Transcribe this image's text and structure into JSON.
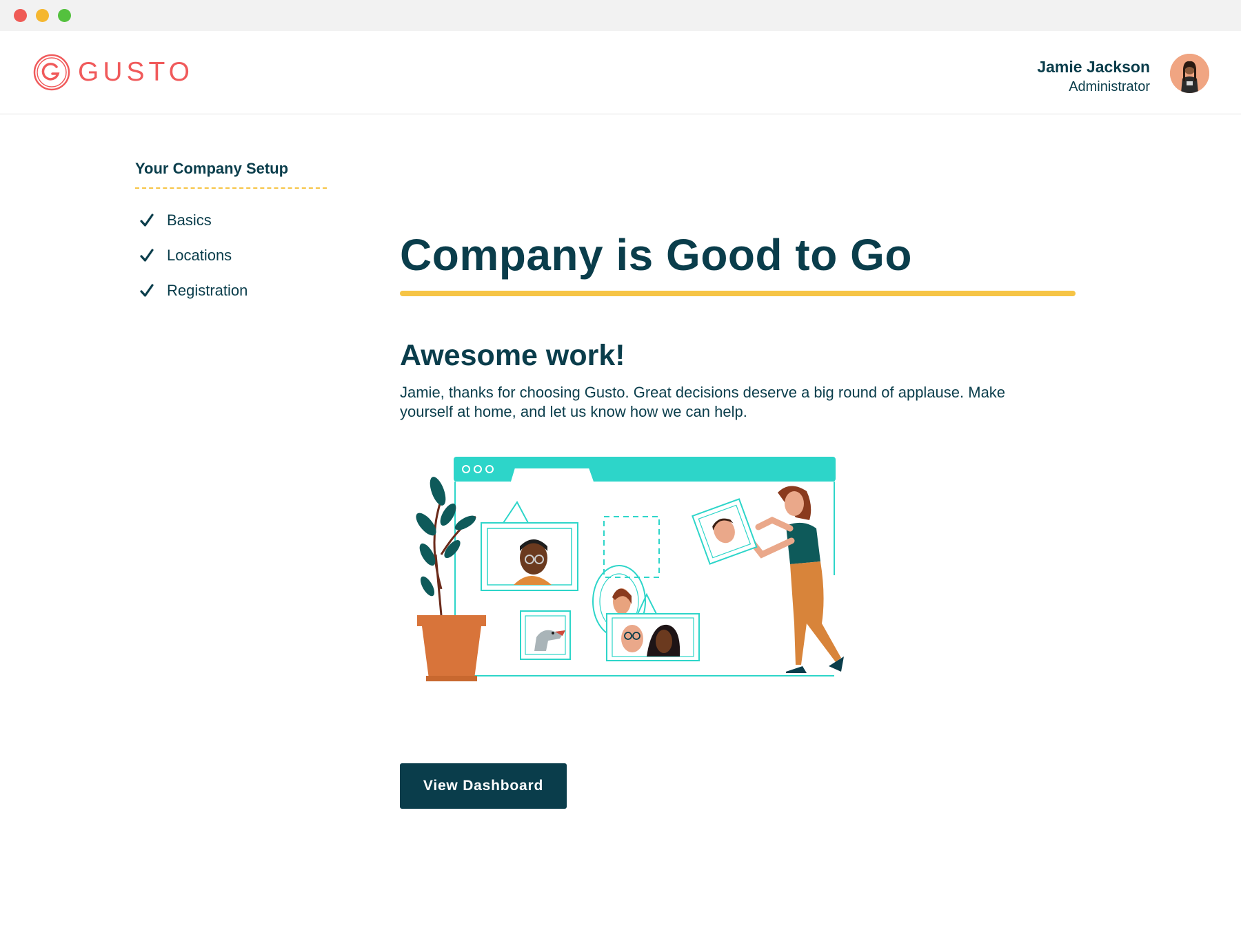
{
  "window": {
    "controls": [
      "close",
      "minimize",
      "maximize"
    ]
  },
  "header": {
    "logo_text": "GUSTO",
    "logo_color": "#f05a5b",
    "user_name": "Jamie Jackson",
    "user_role": "Administrator"
  },
  "sidebar": {
    "title": "Your Company Setup",
    "steps": [
      {
        "label": "Basics",
        "icon": "check-icon",
        "completed": true
      },
      {
        "label": "Locations",
        "icon": "check-icon",
        "completed": true
      },
      {
        "label": "Registration",
        "icon": "check-icon",
        "completed": true
      }
    ]
  },
  "main": {
    "title": "Company is Good to Go",
    "subtitle": "Awesome work!",
    "message": "Jamie, thanks for choosing Gusto. Great decisions deserve a big round of applause. Make yourself at home, and let us know how we can help.",
    "button_label": "View Dashboard"
  },
  "colors": {
    "primary": "#0a3d4b",
    "accent_yellow": "#f6c445",
    "teal": "#2dd5c9",
    "brand_red": "#f05a5b"
  }
}
